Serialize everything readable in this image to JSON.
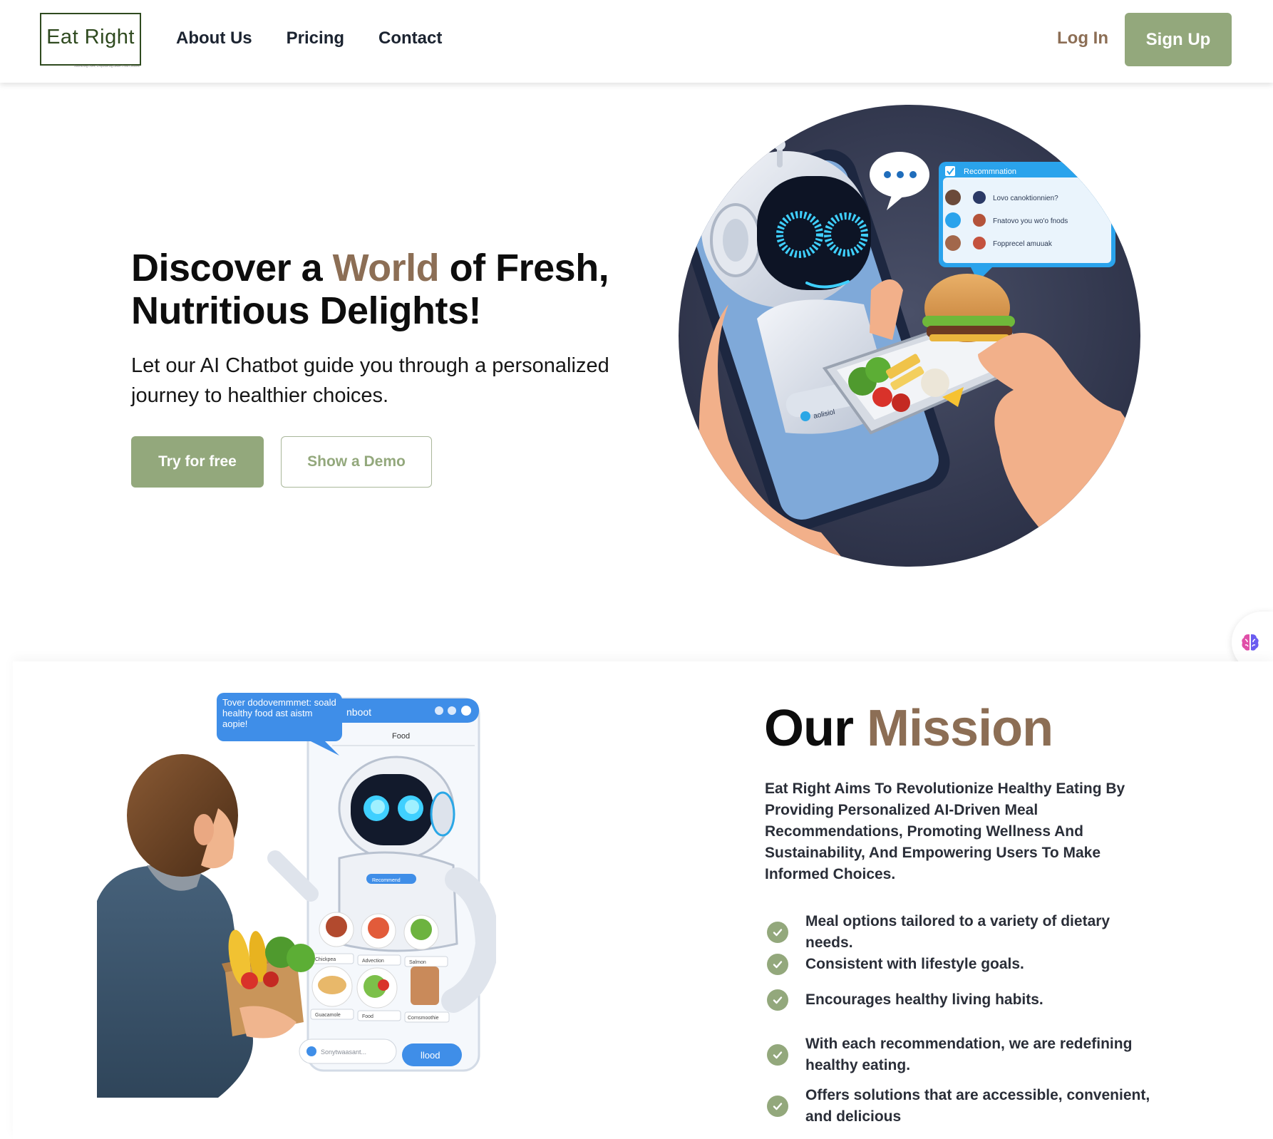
{
  "brand": {
    "logo_text": "Eat Right",
    "logo_tagline": "Nourishing Lives, Empowering Better Food Choices"
  },
  "nav": {
    "items": [
      {
        "label": "About Us"
      },
      {
        "label": "Pricing"
      },
      {
        "label": "Contact"
      }
    ],
    "login_label": "Log In",
    "signup_label": "Sign Up"
  },
  "hero": {
    "title_part1": "Discover a ",
    "title_accent": "World",
    "title_part2": " of Fresh, Nutritious Delights!",
    "subtitle": "Let our AI Chatbot guide you through a personalized journey to healthier choices.",
    "primary_button": "Try for free",
    "secondary_button": "Show a Demo",
    "illustration": {
      "panel_title": "Recommnation",
      "panel_items": [
        "Lovo canoktionnien?",
        "Fnatovo you wo'o fnods",
        "Fopprecel amuuak"
      ],
      "phone_label": "aolisiol"
    }
  },
  "mission": {
    "title_part1": "Our ",
    "title_accent": "Mission",
    "description": "Eat Right Aims To Revolutionize Healthy Eating By Providing Personalized AI-Driven Meal Recommendations, Promoting Wellness And Sustainability, And Empowering Users To Make Informed Choices.",
    "features": [
      "Meal options tailored to a variety of dietary needs.",
      "Consistent with lifestyle goals.",
      "Encourages healthy living habits.",
      "With each recommendation, we are redefining healthy eating.",
      "Offers solutions that are accessible, convenient, and delicious"
    ],
    "illustration": {
      "speech_bubble": "Tover dodovemmmet: soald healthy food ast aistm aopie!",
      "app_title": "nboot",
      "app_tab": "Food",
      "robot_badge": "Recommend",
      "food_labels": [
        "Chickpea",
        "Advection",
        "Salmon",
        "Guacamole",
        "Food",
        "Cornsmoothie"
      ],
      "input_placeholder": "Sonytwaasant...",
      "send_label": "llood"
    }
  },
  "colors": {
    "accent_brown": "#8c6e55",
    "sage_green": "#93a87c",
    "logo_green": "#2f4a1f",
    "text_dark": "#0d0d0d"
  },
  "icons": {
    "side_widget": "brain-icon",
    "feature_bullet": "check-circle-icon"
  }
}
